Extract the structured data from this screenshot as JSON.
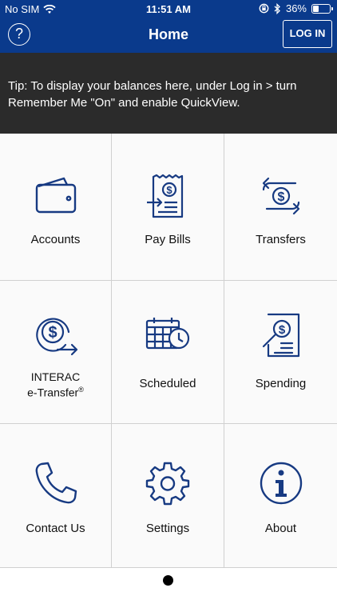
{
  "status_bar": {
    "carrier": "No SIM",
    "time": "11:51 AM",
    "battery": "36%",
    "battery_level": 0.36
  },
  "nav": {
    "help_symbol": "?",
    "title": "Home",
    "login_label": "LOG IN"
  },
  "tip": {
    "text": "Tip: To display your balances here, under Log in > turn Remember Me \"On\" and enable QuickView."
  },
  "tiles": {
    "accounts": {
      "label": "Accounts",
      "icon": "wallet-icon"
    },
    "pay_bills": {
      "label": "Pay Bills",
      "icon": "bill-icon"
    },
    "transfers": {
      "label": "Transfers",
      "icon": "transfer-icon"
    },
    "interac": {
      "label_line1": "INTERAC",
      "label_line2": "e-Transfer",
      "mark": "®",
      "icon": "etransfer-icon"
    },
    "scheduled": {
      "label": "Scheduled",
      "icon": "calendar-clock-icon"
    },
    "spending": {
      "label": "Spending",
      "icon": "spending-report-icon"
    },
    "contact_us": {
      "label": "Contact Us",
      "icon": "phone-icon"
    },
    "settings": {
      "label": "Settings",
      "icon": "gear-icon"
    },
    "about": {
      "label": "About",
      "icon": "info-icon"
    }
  },
  "colors": {
    "brand_blue": "#0a3a8c",
    "icon_blue": "#173a82",
    "tip_bg": "#2b2b2b"
  }
}
